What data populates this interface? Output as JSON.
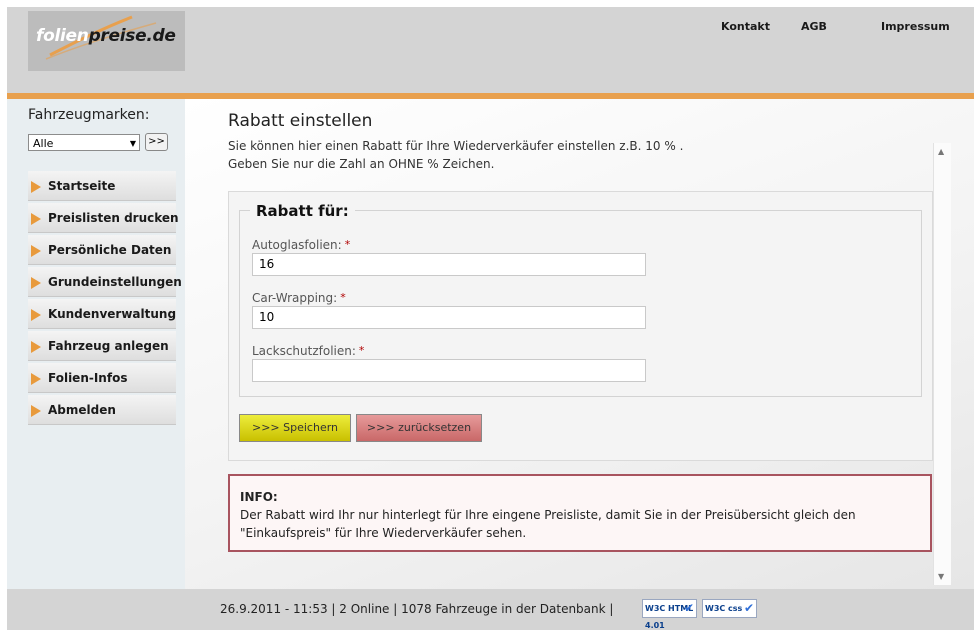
{
  "header": {
    "logo_part1": "folien",
    "logo_part2": "preise.de",
    "links": [
      "Kontakt",
      "AGB",
      "Impressum"
    ]
  },
  "sidebar": {
    "brand_label": "Fahrzeugmarken:",
    "brand_select": "Alle",
    "go_button": ">>",
    "nav": [
      "Startseite",
      "Preislisten drucken",
      "Persönliche Daten",
      "Grundeinstellungen",
      "Kundenverwaltung",
      "Fahrzeug anlegen",
      "Folien-Infos",
      "Abmelden"
    ]
  },
  "main": {
    "title": "Rabatt einstellen",
    "intro_line1": "Sie können hier einen Rabatt für Ihre Wiederverkäufer einstellen z.B. 10 % .",
    "intro_line2": "Geben Sie nur die Zahl an OHNE % Zeichen.",
    "legend": "Rabatt für:",
    "fields": [
      {
        "label": "Autoglasfolien:",
        "value": "16"
      },
      {
        "label": "Car-Wrapping:",
        "value": "10"
      },
      {
        "label": "Lackschutzfolien:",
        "value": ""
      }
    ],
    "required_mark": "*",
    "save_label": ">>> Speichern",
    "reset_label": ">>> zurücksetzen",
    "info_head": "INFO:",
    "info_text": "Der Rabatt wird Ihr nur hinterlegt für Ihre eingene Preisliste, damit Sie in der Preisübersicht gleich den \"Einkaufspreis\" für Ihre Wiederverkäufer sehen."
  },
  "footer": {
    "status": "26.9.2011 - 11:53 | 2 Online | 1078 Fahrzeuge in der Datenbank |",
    "badge_html": "W3C HTML 4.01",
    "badge_css": "W3C css"
  },
  "colors": {
    "accent_orange": "#e8a04e",
    "save_yellow": "#d9d200",
    "reset_red": "#d47878",
    "info_border": "#a8545f"
  }
}
